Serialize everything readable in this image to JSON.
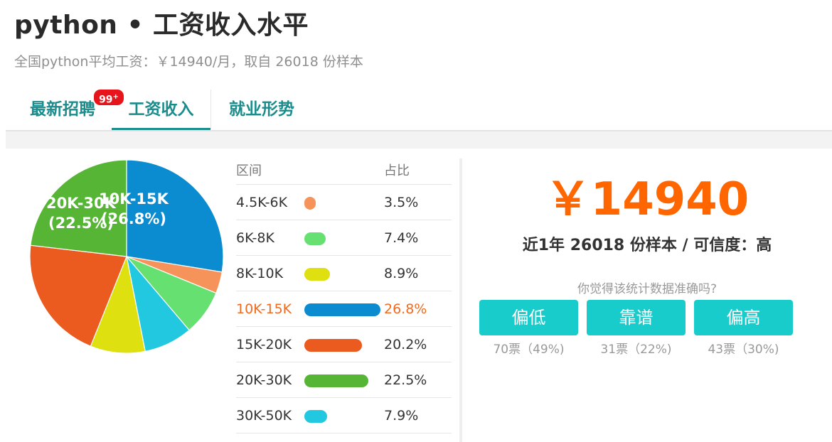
{
  "header": {
    "title": "python • 工资收入水平",
    "subtitle": "全国python平均工资：￥14940/月，取自 26018 份样本"
  },
  "tabs": [
    {
      "label": "最新招聘",
      "badge": "99",
      "badge_suffix": "+"
    },
    {
      "label": "工资收入"
    },
    {
      "label": "就业形势"
    }
  ],
  "table": {
    "col_range": "区间",
    "col_share": "占比",
    "rows": [
      {
        "range": "4.5K-6K",
        "share": "3.5%",
        "value": 3.5,
        "color": "#f5935a"
      },
      {
        "range": "6K-8K",
        "share": "7.4%",
        "value": 7.4,
        "color": "#66e070"
      },
      {
        "range": "8K-10K",
        "share": "8.9%",
        "value": 8.9,
        "color": "#dfe010"
      },
      {
        "range": "10K-15K",
        "share": "26.8%",
        "value": 26.8,
        "color": "#0b8bd0"
      },
      {
        "range": "15K-20K",
        "share": "20.2%",
        "value": 20.2,
        "color": "#eb5a1e"
      },
      {
        "range": "20K-30K",
        "share": "22.5%",
        "value": 22.5,
        "color": "#56b534"
      },
      {
        "range": "30K-50K",
        "share": "7.9%",
        "value": 7.9,
        "color": "#22c8e0"
      }
    ]
  },
  "chart_data": {
    "type": "pie",
    "categories": [
      "10K-15K",
      "4.5K-6K",
      "6K-8K",
      "30K-50K",
      "8K-10K",
      "15K-20K",
      "20K-30K"
    ],
    "values": [
      26.8,
      3.5,
      7.4,
      7.9,
      8.9,
      20.2,
      22.5
    ],
    "colors": [
      "#0b8bd0",
      "#f5935a",
      "#66e070",
      "#22c8e0",
      "#dfe010",
      "#eb5a1e",
      "#56b534"
    ],
    "labels": [
      {
        "range": "10K-15K",
        "pct": "(26.8%)"
      },
      {
        "range": "20K-30K",
        "pct": "(22.5%)"
      }
    ]
  },
  "summary": {
    "average": "￥14940",
    "sample_text": "近1年 26018 份样本 / 可信度：高",
    "question": "你觉得该统计数据准确吗?"
  },
  "votes": [
    {
      "label": "偏低",
      "count": "70票（49%)"
    },
    {
      "label": "靠谱",
      "count": "31票（22%)"
    },
    {
      "label": "偏高",
      "count": "43票（30%)"
    }
  ],
  "colors": {
    "accent": "#1b8c8c",
    "highlight": "#ff6600",
    "vote_button": "#18cccb",
    "badge": "#e8141b"
  }
}
